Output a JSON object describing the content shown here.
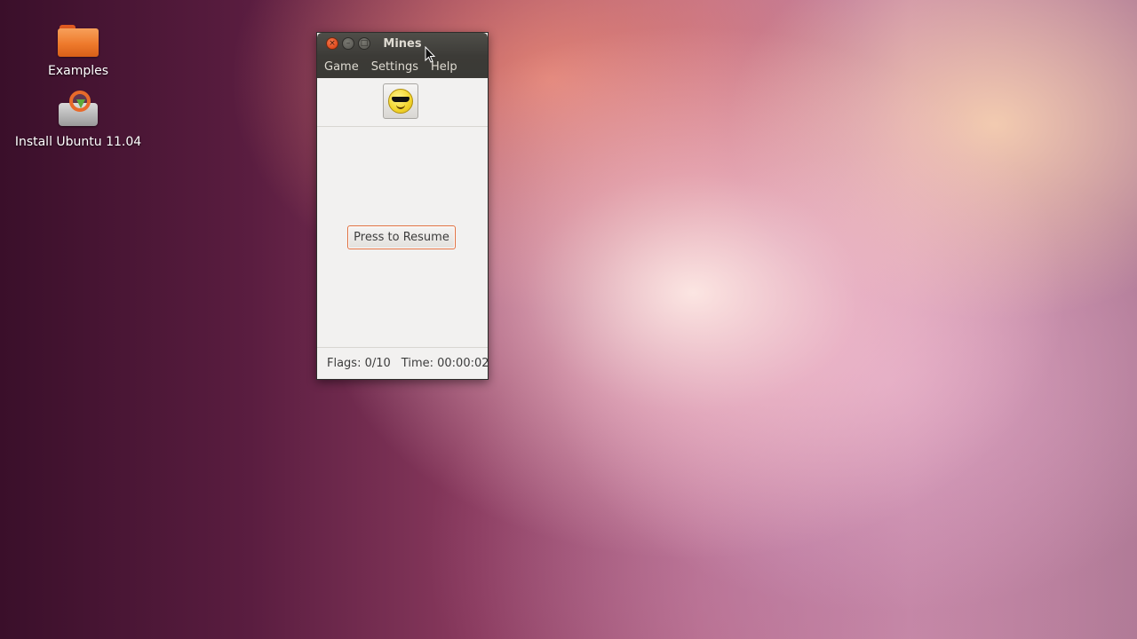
{
  "desktop": {
    "icons": [
      {
        "label": "Examples",
        "icon": "folder-icon"
      },
      {
        "label": "Install Ubuntu 11.04",
        "icon": "installer-icon"
      }
    ]
  },
  "window": {
    "title": "Mines",
    "controls": {
      "close": "×",
      "minimize": "–",
      "maximize": "□"
    },
    "menu": [
      "Game",
      "Settings",
      "Help"
    ],
    "face_icon": "cool-smiley-icon",
    "resume_label": "Press to Resume",
    "status": {
      "flags": "Flags: 0/10",
      "time": "Time: 00:00:02"
    }
  },
  "colors": {
    "titlebar": "#3c3b37",
    "close_button": "#df4a1d",
    "button_focus_border": "#e07040",
    "window_bg": "#f2f1f0"
  }
}
